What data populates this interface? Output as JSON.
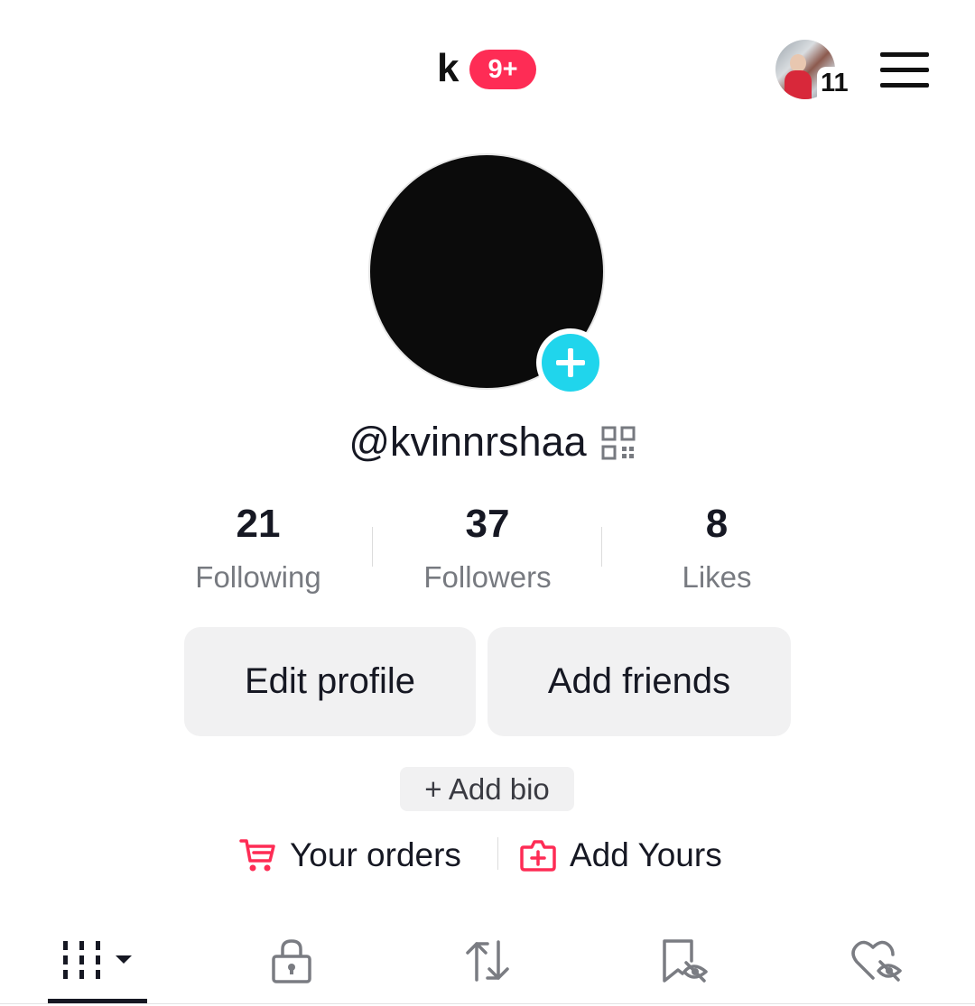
{
  "header": {
    "name_initial": "k",
    "notification_badge": "9+",
    "account_switch_count": "11",
    "menu_icon": "hamburger-menu-icon"
  },
  "profile": {
    "username": "@kvinnrshaa",
    "add_photo_icon": "plus-icon",
    "qr_icon": "qr-code-icon"
  },
  "stats": [
    {
      "value": "21",
      "label": "Following"
    },
    {
      "value": "37",
      "label": "Followers"
    },
    {
      "value": "8",
      "label": "Likes"
    }
  ],
  "actions": {
    "edit_profile": "Edit profile",
    "add_friends": "Add friends",
    "add_bio": "+ Add bio"
  },
  "links": {
    "orders": "Your orders",
    "add_yours": "Add Yours"
  },
  "tabs": [
    {
      "icon": "grid-icon",
      "active": true
    },
    {
      "icon": "lock-icon",
      "active": false
    },
    {
      "icon": "repost-icon",
      "active": false
    },
    {
      "icon": "favorites-hidden-icon",
      "active": false
    },
    {
      "icon": "liked-hidden-icon",
      "active": false
    }
  ],
  "colors": {
    "accent": "#fe2c55",
    "add_photo": "#20d5ec",
    "button_bg": "#f1f1f2",
    "text_secondary": "#777a80"
  }
}
